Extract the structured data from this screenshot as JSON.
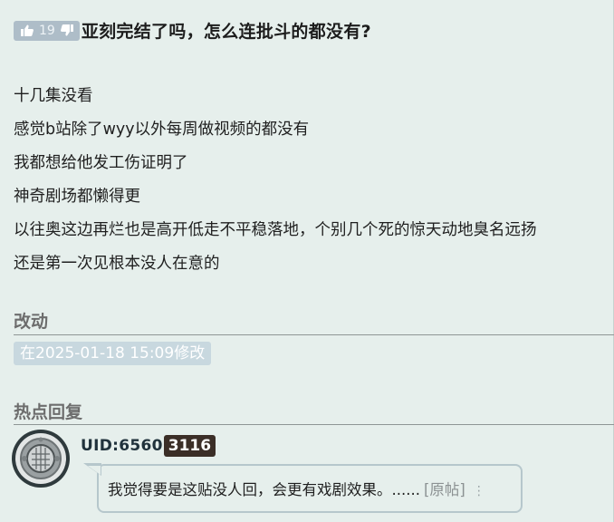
{
  "post": {
    "votes": "19",
    "title": "亚刻完结了吗，怎么连批斗的都没有?",
    "body_lines": [
      "十几集没看",
      "感觉b站除了wyy以外每周做视频的都没有",
      "我都想给他发工伤证明了",
      "神奇剧场都懒得更",
      "以往奥这边再烂也是高开低走不平稳落地，个别几个死的惊天动地臭名远扬",
      "还是第一次见根本没人在意的"
    ]
  },
  "edit": {
    "heading": "改动",
    "note": "在2025-01-18 15:09修改"
  },
  "hot_reply": {
    "heading": "热点回复",
    "uid_prefix": "UID:6560",
    "uid_suffix": "3116",
    "text": "我觉得要是这贴没人回，会更有戏剧效果。......",
    "source_link": "[原帖]",
    "more": "⋮"
  },
  "icons": {
    "upvote": "thumbs-up-icon",
    "downvote": "thumbs-down-icon",
    "avatar": "helmet-avatar-icon",
    "more": "vertical-ellipsis-icon"
  },
  "colors": {
    "page_bg": "#e6efec",
    "vote_badge": "#aebdc8",
    "edit_badge": "#c8d8df",
    "uid_badge": "#3b2e27",
    "bubble_border": "#b6c7cc"
  }
}
